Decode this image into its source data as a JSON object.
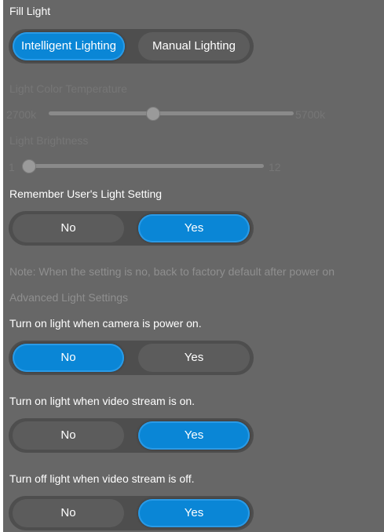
{
  "fill_light": {
    "title": "Fill Light",
    "options": [
      "Intelligent Lighting",
      "Manual Lighting"
    ],
    "selected": "Intelligent Lighting"
  },
  "color_temp": {
    "label": "Light Color Temperature",
    "min_label": "2700k",
    "max_label": "5700k",
    "level": 0.42,
    "disabled": true
  },
  "brightness": {
    "label": "Light Brightness",
    "min_label": "1",
    "max_label": "12",
    "level": 0.0,
    "disabled": true
  },
  "remember": {
    "label": "Remember User's Light Setting",
    "options": [
      "No",
      "Yes"
    ],
    "selected": "Yes"
  },
  "note": "Note: When the setting is no, back to factory default after power on",
  "advanced_title": "Advanced Light Settings",
  "camera_power": {
    "label": "Turn on light when camera is power on.",
    "options": [
      "No",
      "Yes"
    ],
    "selected": "No"
  },
  "stream_on": {
    "label": "Turn on light when video stream is on.",
    "options": [
      "No",
      "Yes"
    ],
    "selected": "Yes"
  },
  "stream_off": {
    "label": "Turn off light when video stream is off.",
    "options": [
      "No",
      "Yes"
    ],
    "selected": "Yes"
  },
  "colors": {
    "panel_bg": "#676767",
    "accent": "#0a86d6",
    "segment_bg": "#4e4e4e"
  }
}
